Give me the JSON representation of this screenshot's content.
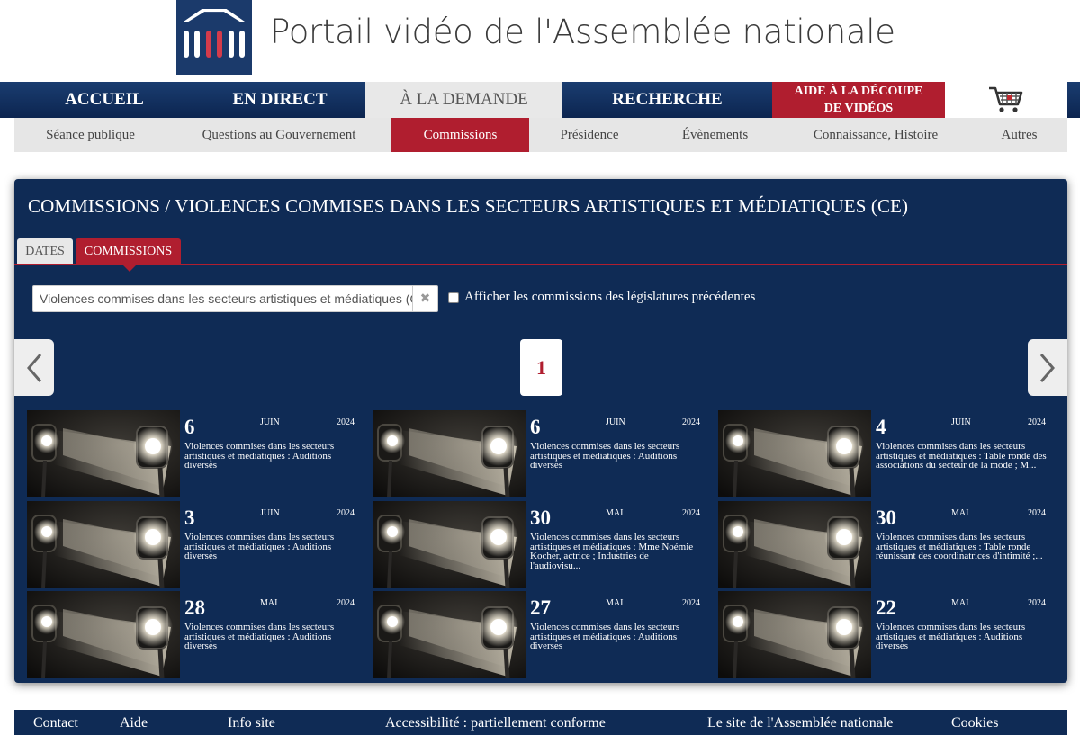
{
  "header": {
    "site_title": "Portail vidéo de l'Assemblée nationale",
    "logo_icon": "assemblee-nationale-logo"
  },
  "main_nav": [
    {
      "label": "ACCUEIL",
      "active": false
    },
    {
      "label": "EN DIRECT",
      "active": false
    },
    {
      "label": "À LA DEMANDE",
      "active": true
    },
    {
      "label": "RECHERCHE",
      "active": false
    }
  ],
  "aide": {
    "line1": "AIDE À LA DÉCOUPE",
    "line2": "DE VIDÉOS"
  },
  "cart_icon": "shopping-cart-icon",
  "sub_nav": [
    {
      "label": "Séance publique"
    },
    {
      "label": "Questions au Gouvernement"
    },
    {
      "label": "Commissions",
      "active": true
    },
    {
      "label": "Présidence"
    },
    {
      "label": "Évènements"
    },
    {
      "label": "Connaissance, Histoire"
    },
    {
      "label": "Autres"
    }
  ],
  "panel": {
    "title": "COMMISSIONS / VIOLENCES COMMISES DANS LES SECTEURS ARTISTIQUES ET MÉDIATIQUES (CE)",
    "tabs": [
      "DATES",
      "COMMISSIONS"
    ],
    "select_value": "Violences commises dans les secteurs artistiques et médiatiques (CE)",
    "clear_symbol": "✖",
    "checkbox_label": "Afficher les commissions des législatures précédentes",
    "page": "1"
  },
  "videos": [
    {
      "day": "6",
      "month": "JUIN",
      "year": "2024",
      "title": "Violences commises dans les secteurs artistiques et médiatiques : Auditions diverses"
    },
    {
      "day": "6",
      "month": "JUIN",
      "year": "2024",
      "title": "Violences commises dans les secteurs artistiques et médiatiques : Auditions diverses"
    },
    {
      "day": "4",
      "month": "JUIN",
      "year": "2024",
      "title": "Violences commises dans les secteurs artistiques et médiatiques : Table ronde des associations du secteur de la mode ; M..."
    },
    {
      "day": "3",
      "month": "JUIN",
      "year": "2024",
      "title": "Violences commises dans les secteurs artistiques et médiatiques : Auditions diverses"
    },
    {
      "day": "30",
      "month": "MAI",
      "year": "2024",
      "title": "Violences commises dans les secteurs artistiques et médiatiques : Mme Noémie Kocher, actrice ; Industries de l'audiovisu..."
    },
    {
      "day": "30",
      "month": "MAI",
      "year": "2024",
      "title": "Violences commises dans les secteurs artistiques et médiatiques : Table ronde réunissant des coordinatrices d'intimité ;..."
    },
    {
      "day": "28",
      "month": "MAI",
      "year": "2024",
      "title": "Violences commises dans les secteurs artistiques et médiatiques : Auditions diverses"
    },
    {
      "day": "27",
      "month": "MAI",
      "year": "2024",
      "title": "Violences commises dans les secteurs artistiques et médiatiques : Auditions diverses"
    },
    {
      "day": "22",
      "month": "MAI",
      "year": "2024",
      "title": "Violences commises dans les secteurs artistiques et médiatiques : Auditions diverses"
    }
  ],
  "footer": [
    {
      "label": "Contact"
    },
    {
      "label": "Aide"
    },
    {
      "label": "Info site"
    },
    {
      "label": "Accessibilité : partiellement conforme"
    },
    {
      "label": "Le site de l'Assemblée nationale"
    },
    {
      "label": "Cookies"
    }
  ],
  "colors": {
    "navy": "#0f2b55",
    "red": "#b01e2f",
    "light_grey": "#e6e6e6"
  }
}
